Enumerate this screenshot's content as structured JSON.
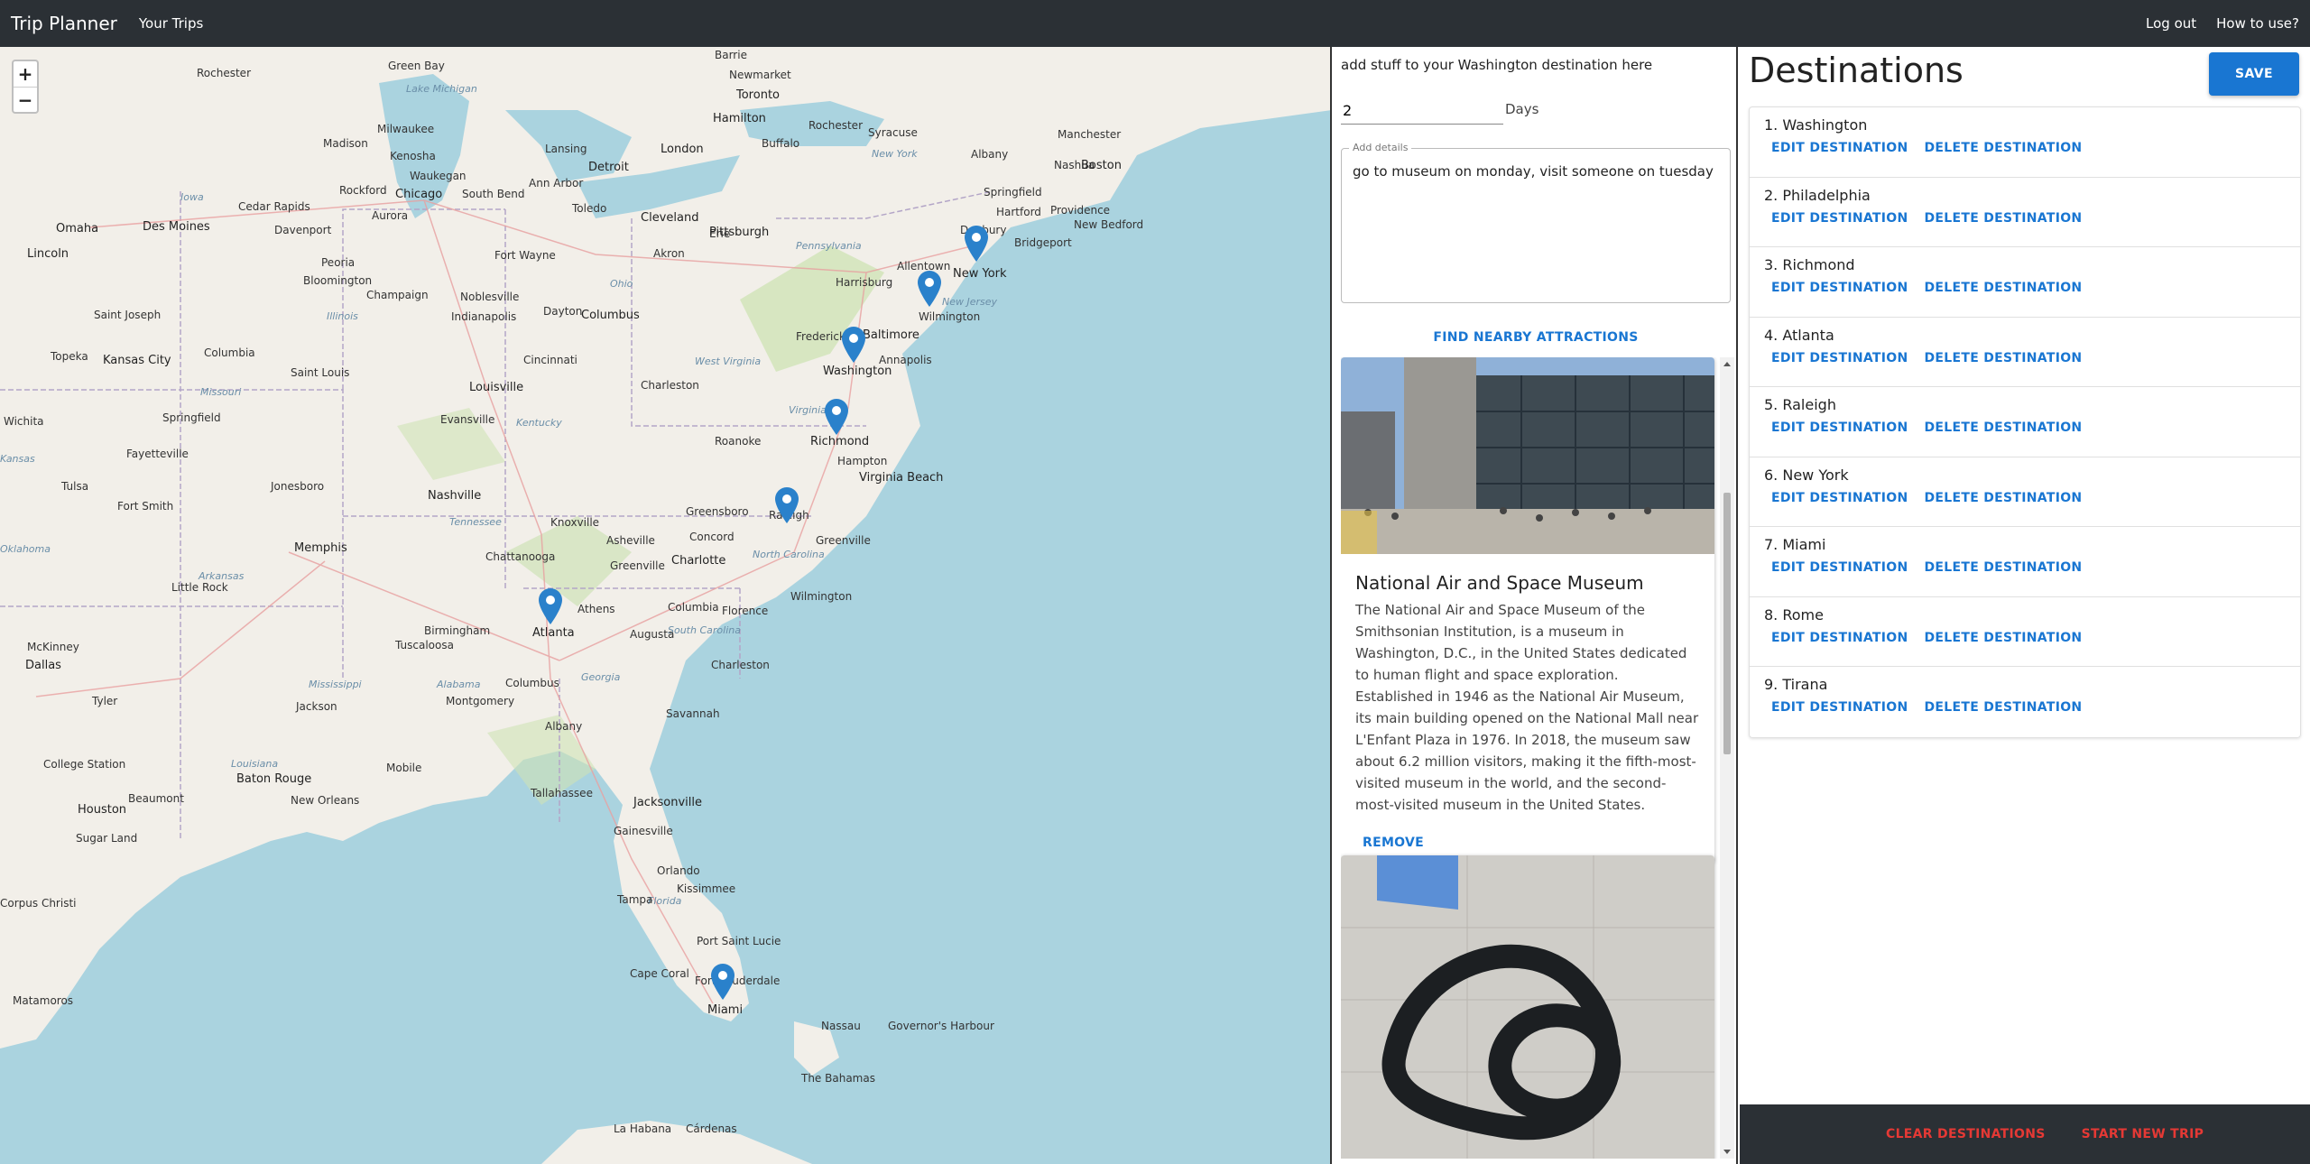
{
  "navbar": {
    "brand": "Trip Planner",
    "your_trips": "Your Trips",
    "logout": "Log out",
    "how_to_use": "How to use?"
  },
  "map": {
    "zoom_in": "+",
    "zoom_out": "−",
    "labels": {
      "rochester_mn": "Rochester",
      "green_bay": "Green Bay",
      "lake_michigan": "Lake Michigan",
      "milwaukee": "Milwaukee",
      "madison": "Madison",
      "kenosha": "Kenosha",
      "waukegan": "Waukegan",
      "rockford": "Rockford",
      "chicago": "Chicago",
      "aurora": "Aurora",
      "south_bend": "South Bend",
      "cedar_rapids": "Cedar Rapids",
      "iowa": "Iowa",
      "omaha": "Omaha",
      "des_moines": "Des Moines",
      "davenport": "Davenport",
      "peoria": "Peoria",
      "lincoln": "Lincoln",
      "bloomington": "Bloomington",
      "champaign": "Champaign",
      "fort_wayne": "Fort Wayne",
      "noblesville": "Noblesville",
      "indianapolis": "Indianapolis",
      "illinois": "Illinois",
      "saint_joseph": "Saint Joseph",
      "kansas_city": "Kansas City",
      "topeka": "Topeka",
      "columbia_mo": "Columbia",
      "missouri": "Missouri",
      "saint_louis": "Saint Louis",
      "springfield_mo": "Springfield",
      "wichita": "Wichita",
      "tulsa": "Tulsa",
      "fayetteville": "Fayetteville",
      "fort_smith": "Fort Smith",
      "jonesboro": "Jonesboro",
      "memphis": "Memphis",
      "arkansas": "Arkansas",
      "little_rock": "Little Rock",
      "mckinney": "McKinney",
      "dallas": "Dallas",
      "tyler": "Tyler",
      "louisiana": "Louisiana",
      "college_station": "College Station",
      "baton_rouge": "Baton Rouge",
      "houston": "Houston",
      "beaumont": "Beaumont",
      "new_orleans": "New Orleans",
      "sugar_land": "Sugar Land",
      "corpus_christi": "Corpus Christi",
      "matamoros": "Matamoros",
      "nashville": "Nashville",
      "tennessee": "Tennessee",
      "knoxville": "Knoxville",
      "chattanooga": "Chattanooga",
      "mississippi": "Mississippi",
      "birmingham": "Birmingham",
      "tuscaloosa": "Tuscaloosa",
      "alabama": "Alabama",
      "jackson": "Jackson",
      "montgomery": "Montgomery",
      "mobile": "Mobile",
      "evansville": "Evansville",
      "louisville": "Louisville",
      "kentucky": "Kentucky",
      "cincinnati": "Cincinnati",
      "columbus_oh": "Columbus",
      "dayton": "Dayton",
      "ohio": "Ohio",
      "toledo": "Toledo",
      "ann_arbor": "Ann Arbor",
      "lansing": "Lansing",
      "detroit": "Detroit",
      "london": "London",
      "cleveland": "Cleveland",
      "akron": "Akron",
      "pittsburgh": "Pittsburgh",
      "erie": "Erie",
      "buffalo": "Buffalo",
      "hamilton": "Hamilton",
      "toronto": "Toronto",
      "newmarket": "Newmarket",
      "barrie": "Barrie",
      "rochester_ny": "Rochester",
      "syracuse": "Syracuse",
      "new_york_state": "New York",
      "albany": "Albany",
      "manchester": "Manchester",
      "nashua": "Nashua",
      "boston": "Boston",
      "springfield_ma": "Springfield",
      "hartford": "Hartford",
      "providence": "Providence",
      "new_bedford": "New Bedford",
      "danbury": "Danbury",
      "bridgeport": "Bridgeport",
      "new_york": "New York",
      "allentown": "Allentown",
      "pennsylvania": "Pennsylvania",
      "harrisburg": "Harrisburg",
      "new_jersey": "New Jersey",
      "wilmington_de": "Wilmington",
      "frederick": "Frederick",
      "baltimore": "Baltimore",
      "washington": "Washington",
      "annapolis": "Annapolis",
      "west_virginia": "West Virginia",
      "charleston_wv": "Charleston",
      "virginia": "Virginia",
      "roanoke": "Roanoke",
      "richmond": "Richmond",
      "hampton": "Hampton",
      "virginia_beach": "Virginia Beach",
      "greensboro": "Greensboro",
      "raleigh": "Raleigh",
      "concord": "Concord",
      "asheville": "Asheville",
      "charlotte": "Charlotte",
      "greenville_nc": "Greenville",
      "north_carolina": "North Carolina",
      "greenville_sc": "Greenville",
      "wilmington_nc": "Wilmington",
      "columbia_sc": "Columbia",
      "south_carolina": "South Carolina",
      "florence": "Florence",
      "athens": "Athens",
      "atlanta": "Atlanta",
      "augusta": "Augusta",
      "georgia": "Georgia",
      "columbus_ga": "Columbus",
      "charleston_sc": "Charleston",
      "savannah": "Savannah",
      "albany_ga": "Albany",
      "tallahassee": "Tallahassee",
      "jacksonville": "Jacksonville",
      "gainesville": "Gainesville",
      "orlando": "Orlando",
      "kissimmee": "Kissimmee",
      "florida": "Florida",
      "tampa": "Tampa",
      "port_st_lucie": "Port Saint Lucie",
      "cape_coral": "Cape Coral",
      "fort_lauderdale": "Fort Lauderdale",
      "miami": "Miami",
      "nassau": "Nassau",
      "governors_harbour": "Governor's Harbour",
      "the_bahamas": "The Bahamas",
      "la_habana": "La Habana",
      "cardenas": "Cárdenas",
      "kansas": "Kansas",
      "oklahoma": "Oklahoma"
    }
  },
  "attractions": {
    "heading": "add stuff to your Washington destination here",
    "days_value": "2",
    "days_label": "Days",
    "details_legend": "Add details",
    "details_value": "go to museum on monday, visit someone on tuesday",
    "find_button": "FIND NEARBY ATTRACTIONS",
    "cards": [
      {
        "title": "National Air and Space Museum",
        "description": "The National Air and Space Museum of the Smithsonian Institution, is a museum in Washington, D.C., in the United States dedicated to human flight and space exploration. Established in 1946 as the National Air Museum, its main building opened on the National Mall near L'Enfant Plaza in 1976. In 2018, the museum saw about 6.2 million visitors, making it the fifth-most-visited museum in the world, and the second-most-visited museum in the United States.",
        "remove": "REMOVE"
      }
    ]
  },
  "destinations": {
    "title": "Destinations",
    "save": "SAVE",
    "edit_label": "EDIT DESTINATION",
    "delete_label": "DELETE DESTINATION",
    "items": [
      "1. Washington",
      "2. Philadelphia",
      "3. Richmond",
      "4. Atlanta",
      "5. Raleigh",
      "6. New York",
      "7. Miami",
      "8. Rome",
      "9. Tirana"
    ],
    "clear": "CLEAR DESTINATIONS",
    "start_new": "START NEW TRIP"
  },
  "colors": {
    "navbar": "#2b3035",
    "primary": "#1976d2",
    "danger": "#e53935",
    "water": "#aad3df",
    "land": "#f2efe9",
    "marker": "#2a81cb"
  }
}
